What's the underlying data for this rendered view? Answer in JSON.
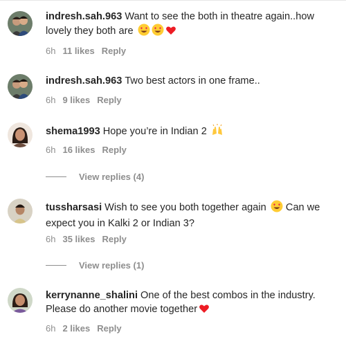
{
  "comments": [
    {
      "username": "indresh.sah.963",
      "text": "Want to see the both in theatre again..how lovely they both are",
      "time": "6h",
      "likes": "11 likes",
      "reply": "Reply",
      "emojis": [
        "heart-eyes-emoji",
        "heart-eyes-emoji",
        "red-heart-emoji"
      ]
    },
    {
      "username": "indresh.sah.963",
      "text": "Two best actors in one frame..",
      "time": "6h",
      "likes": "9 likes",
      "reply": "Reply",
      "emojis": []
    },
    {
      "username": "shema1993",
      "text": "Hope you’re in Indian 2",
      "time": "6h",
      "likes": "16 likes",
      "reply": "Reply",
      "emojis": [
        "raising-hands-emoji"
      ],
      "view_replies": "View replies (4)"
    },
    {
      "username": "tussharsasi",
      "text_before_emoji": "Wish to see you both together again",
      "text_after_emoji": "Can we expect you in Kalki 2 or Indian 3?",
      "time": "6h",
      "likes": "35 likes",
      "reply": "Reply",
      "emojis": [
        "heart-eyes-emoji"
      ],
      "view_replies": "View replies (1)"
    },
    {
      "username": "kerrynanne_shalini",
      "text": "One of the best combos in the industry. Please do another movie together",
      "time": "6h",
      "likes": "2 likes",
      "reply": "Reply",
      "emojis": [
        "red-heart-emoji"
      ]
    }
  ],
  "colors": {
    "text": "#262626",
    "meta": "#8e8e8e",
    "heart": "#ed1c24",
    "emoji_face": "#ffcc33"
  }
}
